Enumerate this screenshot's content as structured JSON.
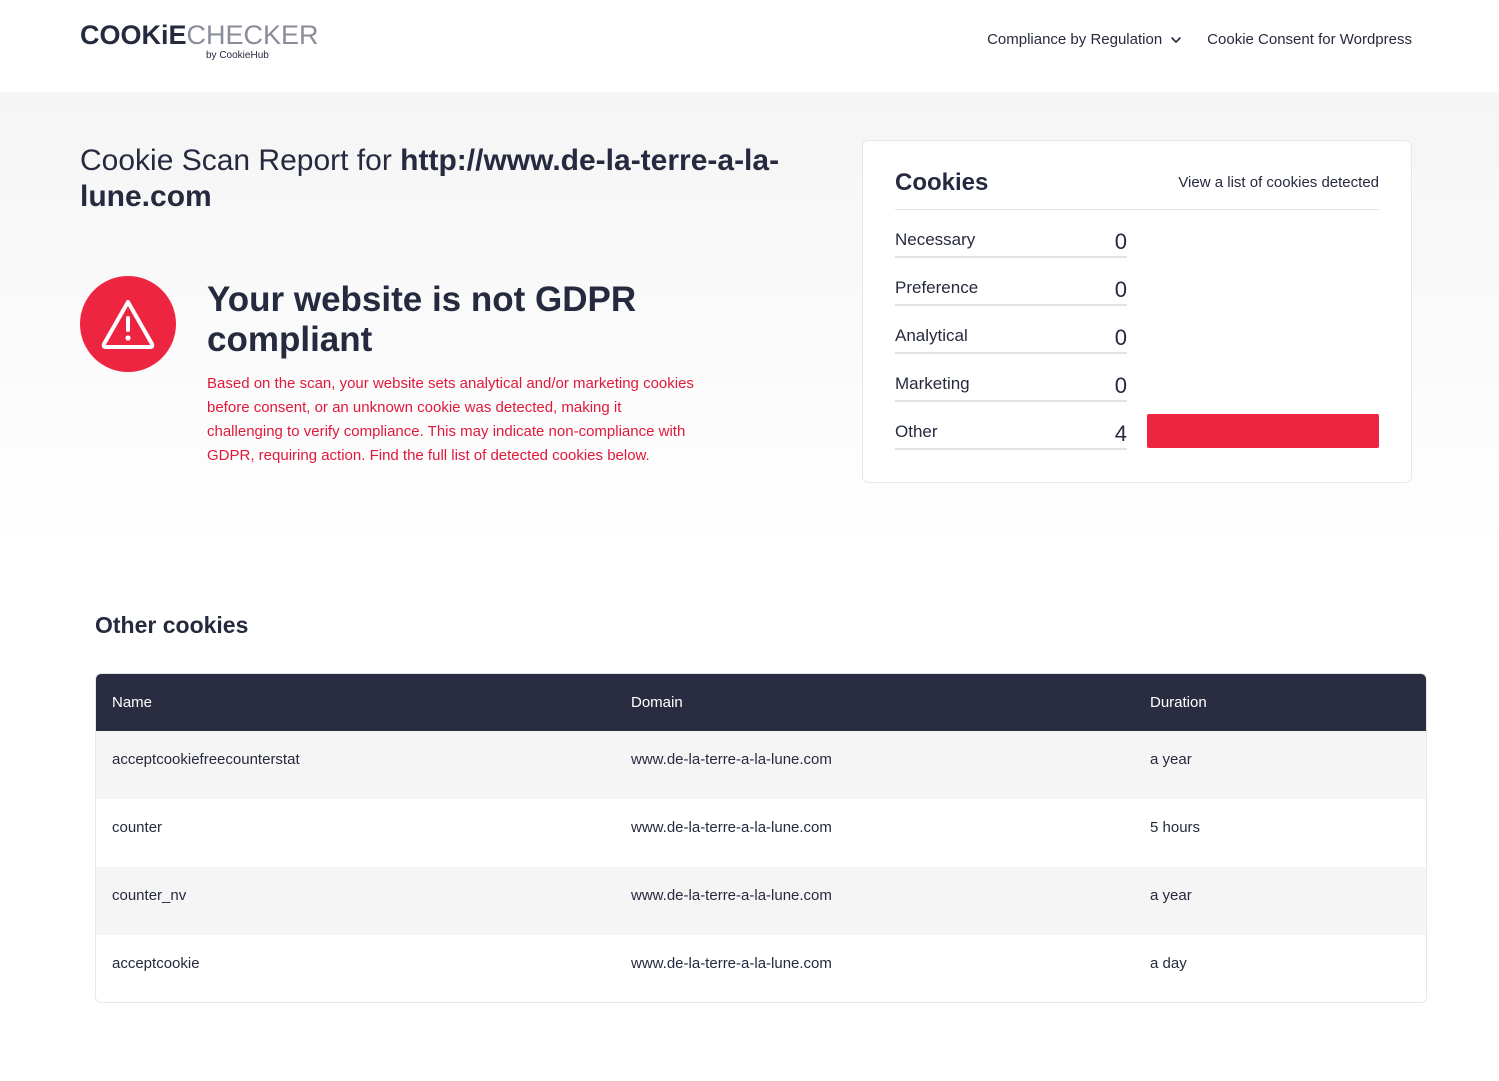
{
  "header": {
    "logo": {
      "bold": "COOKiE",
      "light": "CHECKER",
      "sub": "by CookieHub"
    },
    "nav": [
      {
        "label": "Compliance by Regulation",
        "icon": "chevron-down-icon"
      },
      {
        "label": "Cookie Consent for Wordpress"
      }
    ]
  },
  "report": {
    "title_prefix": "Cookie Scan Report for ",
    "url": "http://www.de-la-terre-a-la-lune.com"
  },
  "warning": {
    "icon": "warning-triangle-icon",
    "title": "Your website is not GDPR compliant",
    "text": "Based on the scan, your website sets analytical and/or marketing cookies before consent, or an unknown cookie was detected, making it challenging to verify compliance. This may indicate non-compliance with GDPR, requiring action. Find the full list of detected cookies below."
  },
  "cookies_card": {
    "title": "Cookies",
    "link": "View a list of cookies detected",
    "categories": [
      {
        "label": "Necessary",
        "count": "0",
        "share": 0
      },
      {
        "label": "Preference",
        "count": "0",
        "share": 0
      },
      {
        "label": "Analytical",
        "count": "0",
        "share": 0
      },
      {
        "label": "Marketing",
        "count": "0",
        "share": 0
      },
      {
        "label": "Other",
        "count": "4",
        "share": 1
      }
    ]
  },
  "other_cookies": {
    "title": "Other cookies",
    "columns": [
      "Name",
      "Domain",
      "Duration"
    ],
    "rows": [
      [
        "acceptcookiefreecounterstat",
        "www.de-la-terre-a-la-lune.com",
        "a year"
      ],
      [
        "counter",
        "www.de-la-terre-a-la-lune.com",
        "5 hours"
      ],
      [
        "counter_nv",
        "www.de-la-terre-a-la-lune.com",
        "a year"
      ],
      [
        "acceptcookie",
        "www.de-la-terre-a-la-lune.com",
        "a day"
      ]
    ]
  },
  "colors": {
    "accent": "#ed2540",
    "dark": "#262a3e",
    "table_header": "#2a2d42"
  }
}
